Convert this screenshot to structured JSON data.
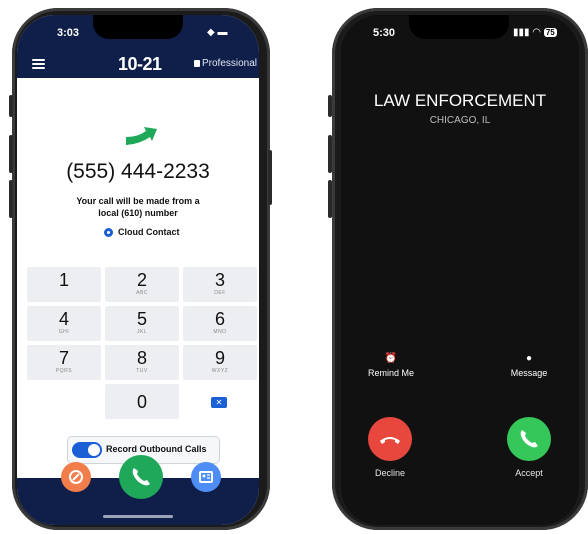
{
  "left_phone": {
    "status": {
      "time": "3:03",
      "icons": "◆ ▬"
    },
    "header": {
      "brand": "10-21",
      "plan": "Professional"
    },
    "dialed_number": "(555) 444-2233",
    "note": "Your call will be made from a local (610) number",
    "cloud_option": "Cloud Contact",
    "keypad": [
      {
        "digit": "1",
        "letters": ""
      },
      {
        "digit": "2",
        "letters": "ABC"
      },
      {
        "digit": "3",
        "letters": "DEF"
      },
      {
        "digit": "4",
        "letters": "GHI"
      },
      {
        "digit": "5",
        "letters": "JKL"
      },
      {
        "digit": "6",
        "letters": "MNO"
      },
      {
        "digit": "7",
        "letters": "PQRS"
      },
      {
        "digit": "8",
        "letters": "TUV"
      },
      {
        "digit": "9",
        "letters": "WXYZ"
      },
      {
        "digit": "0",
        "letters": ""
      }
    ],
    "backspace_icon": "✕",
    "record_label": "Record Outbound Calls",
    "record_enabled": true,
    "colors": {
      "navy": "#0f1f4a",
      "accent": "#1a5fd6",
      "green": "#1fa85a",
      "orange": "#f07d4a",
      "blue_btn": "#4d8df5"
    }
  },
  "right_phone": {
    "status": {
      "time": "5:30",
      "battery": "75"
    },
    "caller": "LAW ENFORCEMENT",
    "location": "CHICAGO, IL",
    "remind_label": "Remind Me",
    "message_label": "Message",
    "decline_label": "Decline",
    "accept_label": "Accept",
    "colors": {
      "decline": "#e8473e",
      "accept": "#35c759"
    }
  }
}
